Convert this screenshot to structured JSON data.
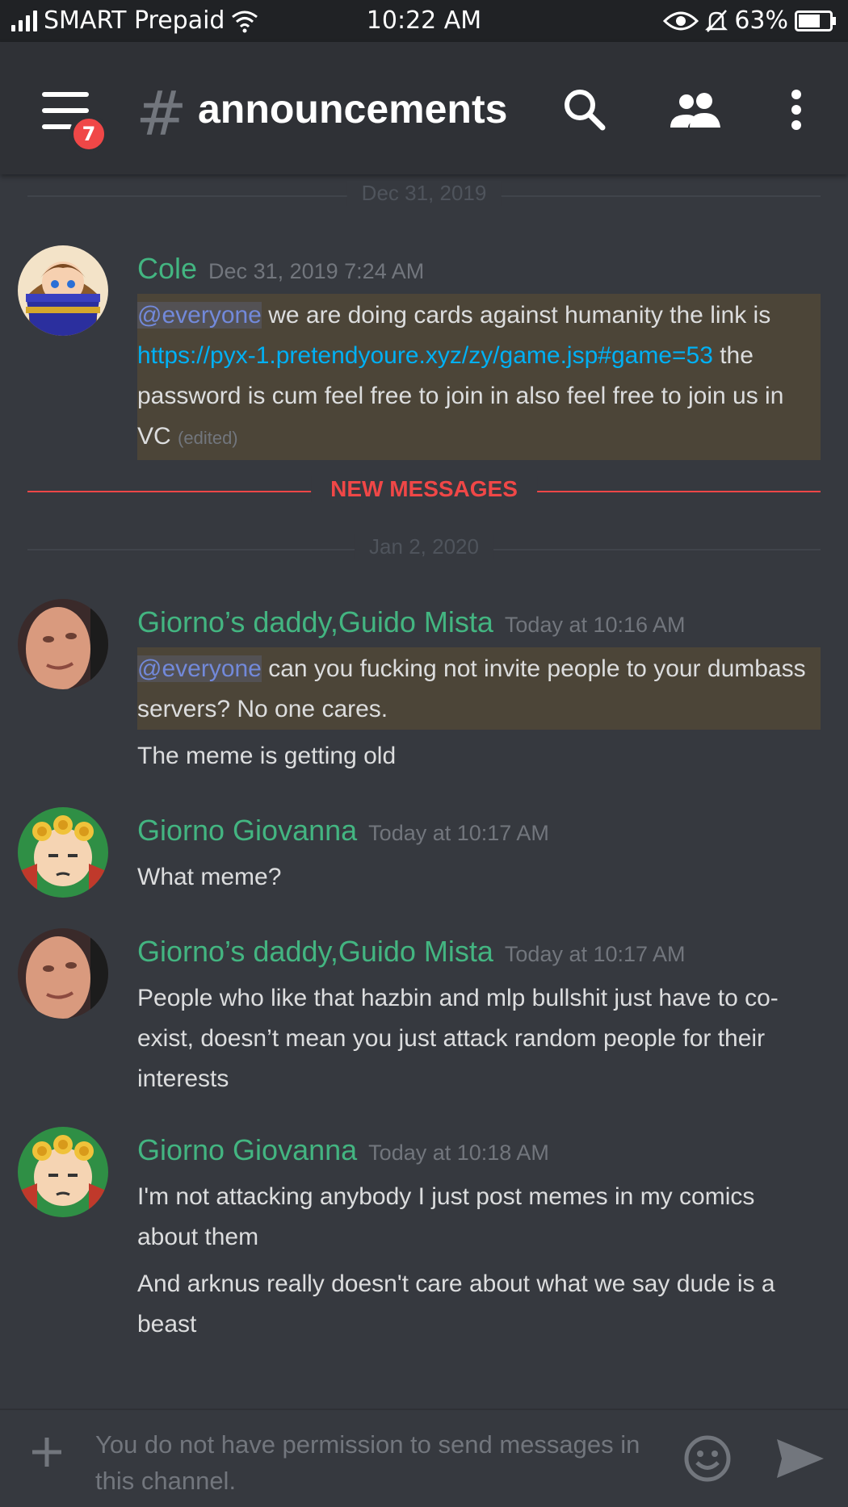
{
  "status_bar": {
    "carrier": "SMART Prepaid",
    "time": "10:22 AM",
    "battery": "63%"
  },
  "header": {
    "menu_badge": "7",
    "channel_hash": "#",
    "channel_name": "announcements",
    "icons": [
      "menu-icon",
      "search-icon",
      "members-icon",
      "more-vertical-icon"
    ]
  },
  "dividers": {
    "date1": "Dec 31, 2019",
    "new_messages": "NEW MESSAGES",
    "date2": "Jan 2, 2020"
  },
  "messages": [
    {
      "author": "Cole",
      "timestamp": "Dec 31, 2019 7:24 AM",
      "mention": "@everyone",
      "text_a": " we are doing cards against humanity the link is ",
      "link": "https://pyx-1.pretendyoure.xyz/zy/game.jsp#game=53",
      "text_b": " the password is cum feel free to join in also feel free to join us in VC",
      "edited": "(edited)"
    },
    {
      "author": "Giorno’s daddy,Guido Mista",
      "timestamp": "Today at 10:16 AM",
      "mention": "@everyone",
      "text_a": " can you fucking not invite people to your dumbass servers? No one cares.",
      "text_c": "The meme is getting old"
    },
    {
      "author": "Giorno Giovanna",
      "timestamp": "Today at 10:17 AM",
      "text_a": "What meme?"
    },
    {
      "author": "Giorno’s daddy,Guido Mista",
      "timestamp": "Today at 10:17 AM",
      "text_a": "People who like that hazbin and mlp bullshit just have to co-exist, doesn’t mean you just attack random people for their interests"
    },
    {
      "author": "Giorno Giovanna",
      "timestamp": "Today at 10:18 AM",
      "text_a": "I'm not attacking anybody I just post memes in my comics about them",
      "text_c": "And arknus really doesn't care about what we say dude is a beast"
    }
  ],
  "composer": {
    "placeholder": "You do not have permission to send messages in this channel."
  },
  "colors": {
    "background": "#36393f",
    "header": "#2f3136",
    "author_green": "#43b581",
    "mention": "#7289da",
    "link": "#00b0f4",
    "new_messages": "#f04747",
    "mention_highlight": "#4c4538"
  }
}
